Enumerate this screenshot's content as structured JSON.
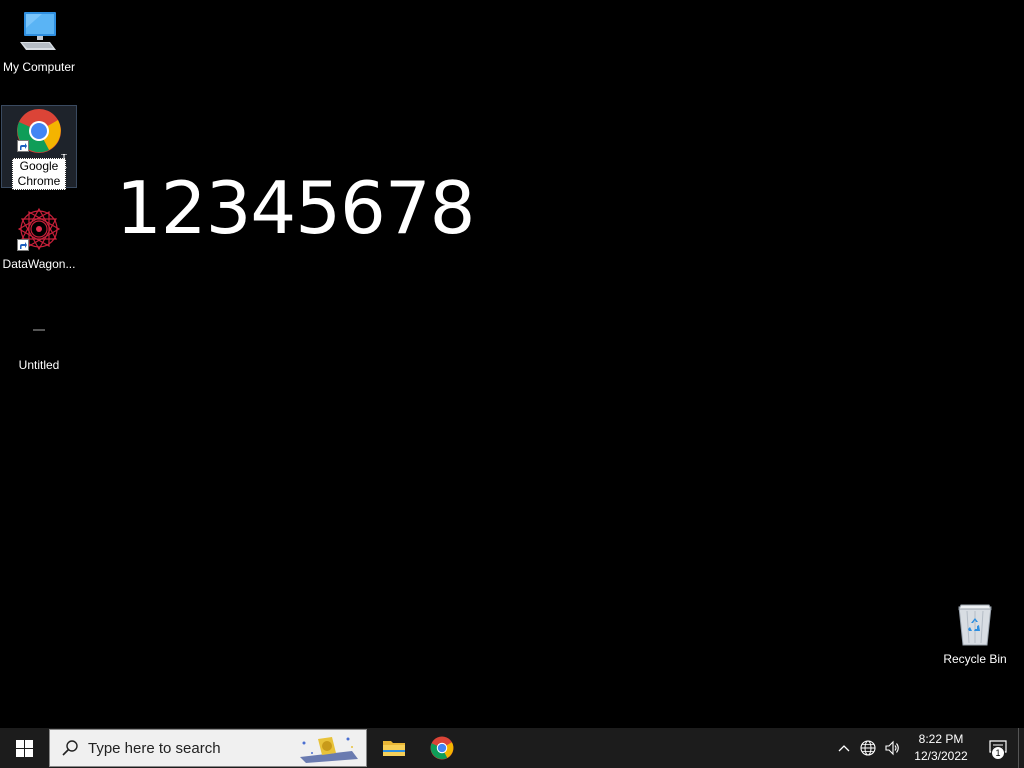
{
  "desktop": {
    "big_text": "12345678",
    "icons": [
      {
        "label": "My Computer",
        "icon": "computer-icon"
      },
      {
        "label": "Google Chrome",
        "icon": "chrome-icon",
        "selected": true
      },
      {
        "label": "DataWagon...",
        "icon": "datawagon-icon"
      },
      {
        "label": "Untitled",
        "icon": "blank-file-icon"
      },
      {
        "label": "Recycle Bin",
        "icon": "recycle-bin-icon"
      }
    ]
  },
  "taskbar": {
    "search_placeholder": "Type here to search",
    "apps": [
      {
        "name": "File Explorer",
        "icon": "folder-icon"
      },
      {
        "name": "Google Chrome",
        "icon": "chrome-icon"
      }
    ],
    "tray": {
      "time": "8:22 PM",
      "date": "12/3/2022",
      "notification_count": "1",
      "icons": [
        "chevron-up-icon",
        "network-globe-icon",
        "speaker-icon"
      ]
    }
  },
  "colors": {
    "desktop_bg": "#000000",
    "taskbar_bg": "#1c1c1c",
    "chrome_red": "#db4437",
    "chrome_yellow": "#f4b400",
    "chrome_green": "#0f9d58",
    "chrome_blue": "#4285f4"
  }
}
